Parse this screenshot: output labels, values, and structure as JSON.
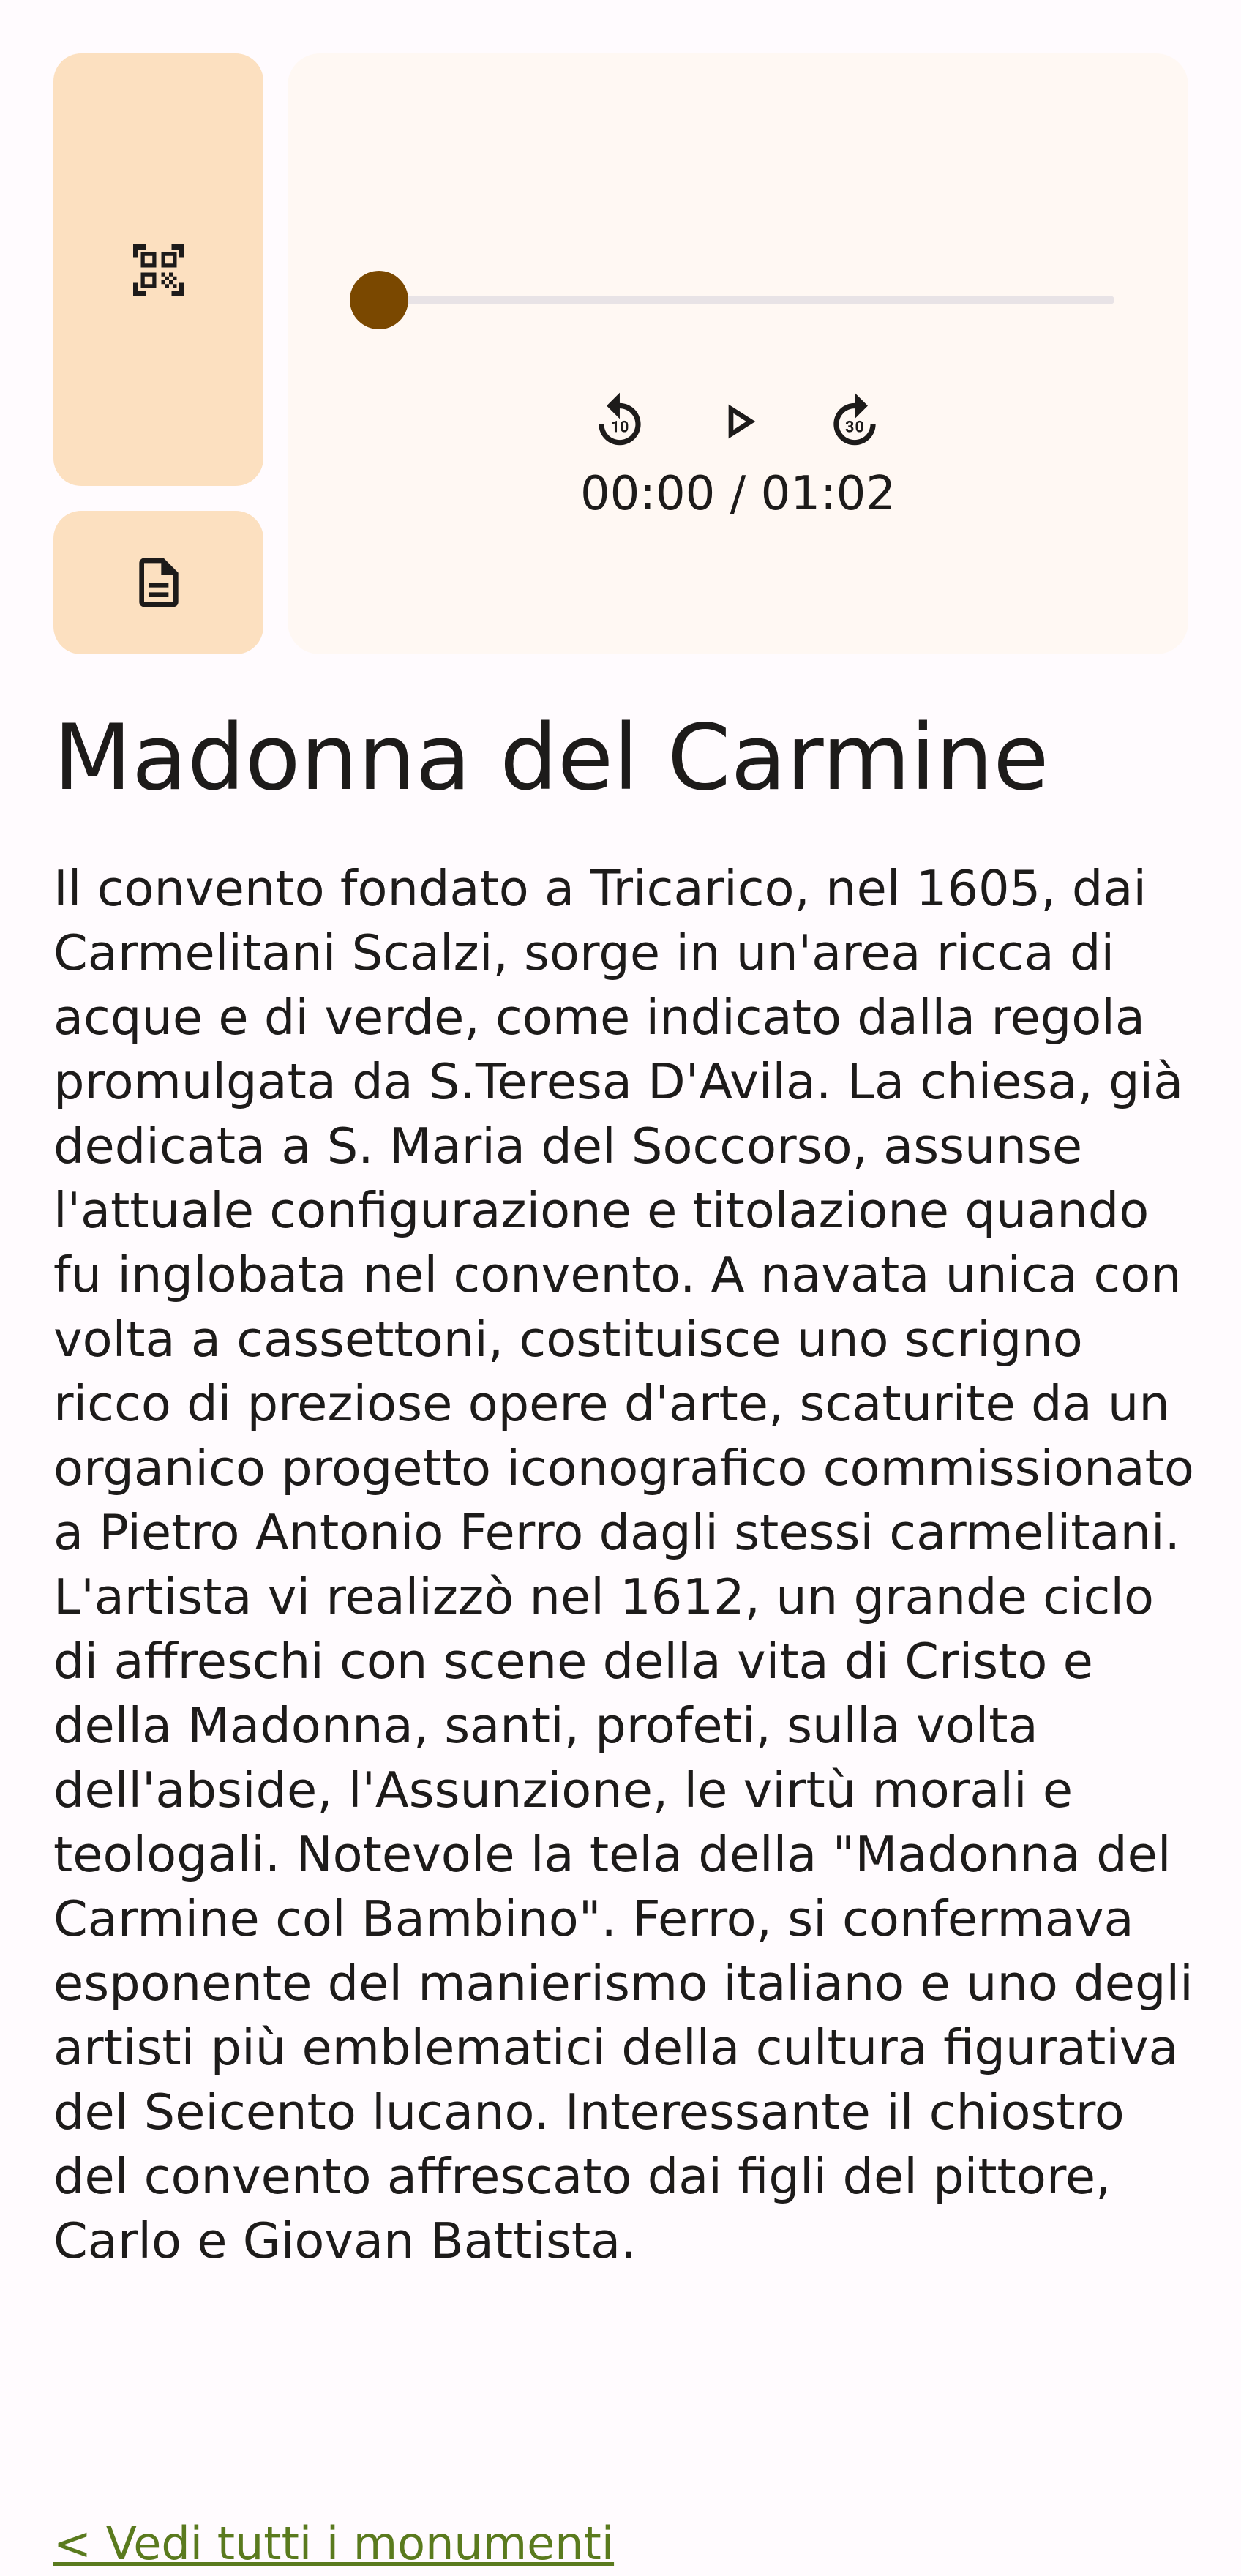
{
  "icons": {
    "qr": "qr-code-scanner-icon",
    "doc": "document-icon",
    "rewind": "replay-10-icon",
    "play": "play-icon",
    "forward": "forward-10-icon"
  },
  "player": {
    "progress": 0,
    "time_label": "00:00 / 01:02"
  },
  "monument": {
    "title": "Madonna del Carmine",
    "description": "Il convento fondato a Tricarico, nel 1605, dai Carmelitani Scalzi, sorge in un'area ricca di acque e di verde, come indicato dalla regola promulgata da S.Teresa D'Avila. La chiesa, già dedicata a S. Maria del Soccorso, assunse l'attuale configurazione e titolazione quando fu inglobata nel convento. A navata unica con volta a cassettoni, costituisce uno scrigno ricco di preziose opere d'arte, scaturite da un organico progetto iconografico commissionato a Pietro Antonio Ferro dagli stessi carmelitani. L'artista vi realizzò nel 1612, un grande ciclo di affreschi con scene della vita di Cristo e della Madonna, santi, profeti, sulla volta dell'abside, l'Assunzione, le virtù morali e teologali. Notevole la tela della \"Madonna del Carmine col Bambino\". Ferro, si confermava esponente del manierismo italiano e uno degli artisti più emblematici della cultura figurativa del Seicento lucano. Interessante il chiostro del convento affrescato dai figli del pittore, Carlo e Giovan Battista."
  },
  "links": {
    "all_monuments": "< Vedi tutti i monumenti"
  },
  "colors": {
    "side_button_bg": "#fce0c0",
    "player_bg": "#fff8f3",
    "thumb": "#7a4800",
    "link": "#5a7a1e"
  }
}
